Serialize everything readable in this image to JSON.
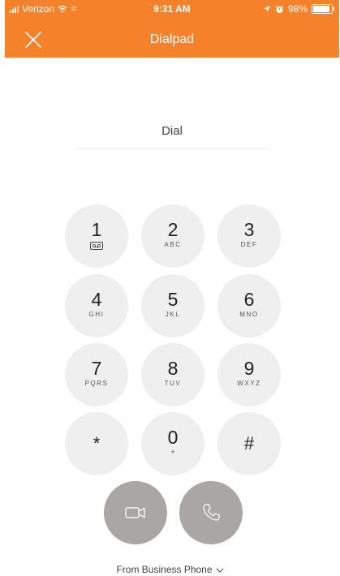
{
  "status_bar": {
    "carrier": "Verizon",
    "time": "9:31 AM",
    "battery": "98%"
  },
  "header": {
    "title": "Dialpad",
    "close_icon": "close-icon"
  },
  "dial": {
    "label": "Dial"
  },
  "keypad": [
    {
      "num": "1",
      "letters": ""
    },
    {
      "num": "2",
      "letters": "ABC"
    },
    {
      "num": "3",
      "letters": "DEF"
    },
    {
      "num": "4",
      "letters": "GHI"
    },
    {
      "num": "5",
      "letters": "JKL"
    },
    {
      "num": "6",
      "letters": "MNO"
    },
    {
      "num": "7",
      "letters": "PQRS"
    },
    {
      "num": "8",
      "letters": "TUV"
    },
    {
      "num": "9",
      "letters": "WXYZ"
    },
    {
      "num": "*",
      "letters": ""
    },
    {
      "num": "0",
      "letters": "+"
    },
    {
      "num": "#",
      "letters": ""
    }
  ],
  "actions": {
    "video_icon": "video-camera-icon",
    "call_icon": "phone-icon"
  },
  "footer": {
    "from_label": "From Business Phone"
  },
  "colors": {
    "brand_orange": "#f5812a",
    "key_bg": "#efefef",
    "action_bg": "#aaa6a3"
  }
}
